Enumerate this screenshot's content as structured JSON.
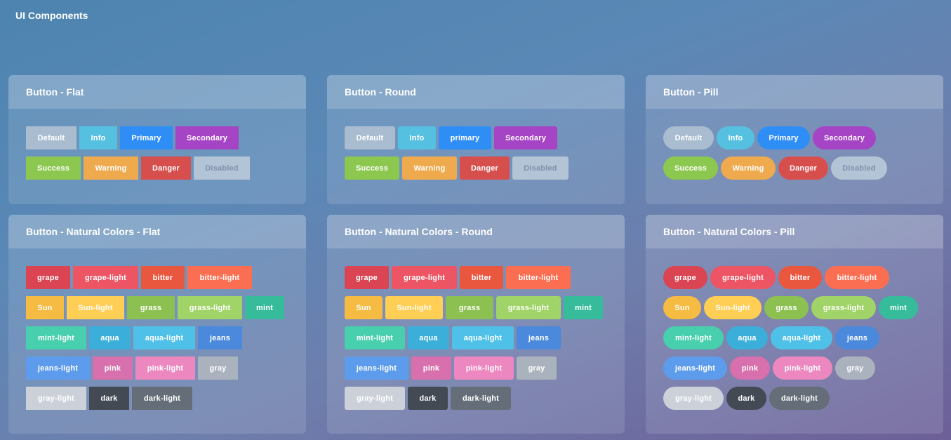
{
  "page": {
    "title": "UI Components"
  },
  "colors": {
    "default": "#aabdd0",
    "info": "#56c0e0",
    "primary": "#2f8ef5",
    "secondary": "#a544c4",
    "success": "#8cc74f",
    "warning": "#efaa4e",
    "danger": "#d74f4c",
    "disabled": "#b3c4d6",
    "grape": "#da4453",
    "grape-light": "#ed5565",
    "bitter": "#e9573f",
    "bitter-light": "#fc6e51",
    "sun": "#f6bb42",
    "sun-light": "#ffce54",
    "grass": "#8cc152",
    "grass-light": "#a0d468",
    "mint": "#37bc9b",
    "mint-light": "#48cfad",
    "aqua": "#3bafda",
    "aqua-light": "#4fc1e9",
    "jeans": "#4a89dc",
    "jeans-light": "#5d9cec",
    "pink": "#d770ad",
    "pink-light": "#ec87c0",
    "gray": "#aab2bd",
    "gray-light": "#ccd1d9",
    "dark": "#434a54",
    "dark-light": "#656d78"
  },
  "panels": [
    {
      "title": "Button - Flat",
      "style": "flat",
      "buttons": [
        {
          "label": "Default",
          "color": "default",
          "w": 72
        },
        {
          "label": "Info",
          "color": "info",
          "w": 54
        },
        {
          "label": "Primary",
          "color": "primary",
          "w": 75
        },
        {
          "label": "Secondary",
          "color": "secondary",
          "w": 90
        },
        {
          "label": "Success",
          "color": "success",
          "w": 78
        },
        {
          "label": "Warning",
          "color": "warning",
          "w": 78
        },
        {
          "label": "Danger",
          "color": "danger",
          "w": 71
        },
        {
          "label": "Disabled",
          "color": "disabled",
          "w": 80,
          "disabled": true
        }
      ]
    },
    {
      "title": "Button - Round",
      "style": "round",
      "buttons": [
        {
          "label": "Default",
          "color": "default",
          "w": 72
        },
        {
          "label": "Info",
          "color": "info",
          "w": 54
        },
        {
          "label": "primary",
          "color": "primary",
          "w": 75
        },
        {
          "label": "Secondary",
          "color": "secondary",
          "w": 90
        },
        {
          "label": "Success",
          "color": "success",
          "w": 78
        },
        {
          "label": "Warning",
          "color": "warning",
          "w": 78
        },
        {
          "label": "Danger",
          "color": "danger",
          "w": 71
        },
        {
          "label": "Disabled",
          "color": "disabled",
          "w": 80,
          "disabled": true
        }
      ]
    },
    {
      "title": "Button - Pill",
      "style": "pill",
      "buttons": [
        {
          "label": "Default",
          "color": "default",
          "w": 72
        },
        {
          "label": "Info",
          "color": "info",
          "w": 54
        },
        {
          "label": "Primary",
          "color": "primary",
          "w": 75
        },
        {
          "label": "Secondary",
          "color": "secondary",
          "w": 90
        },
        {
          "label": "Success",
          "color": "success",
          "w": 78
        },
        {
          "label": "Warning",
          "color": "warning",
          "w": 78
        },
        {
          "label": "Danger",
          "color": "danger",
          "w": 71
        },
        {
          "label": "Disabled",
          "color": "disabled",
          "w": 80,
          "disabled": true
        }
      ]
    },
    {
      "title": "Button - Natural Colors - Flat",
      "style": "flat",
      "buttons": [
        {
          "label": "grape",
          "color": "grape",
          "w": 63
        },
        {
          "label": "grape-light",
          "color": "grape-light",
          "w": 93
        },
        {
          "label": "bitter",
          "color": "bitter",
          "w": 62
        },
        {
          "label": "bitter-light",
          "color": "bitter-light",
          "w": 92
        },
        {
          "label": "Sun",
          "color": "sun",
          "w": 54
        },
        {
          "label": "Sun-light",
          "color": "sun-light",
          "w": 82
        },
        {
          "label": "grass",
          "color": "grass",
          "w": 68
        },
        {
          "label": "grass-light",
          "color": "grass-light",
          "w": 92
        },
        {
          "label": "mint",
          "color": "mint",
          "w": 56
        },
        {
          "label": "mint-light",
          "color": "mint-light",
          "w": 86
        },
        {
          "label": "aqua",
          "color": "aqua",
          "w": 59
        },
        {
          "label": "aqua-light",
          "color": "aqua-light",
          "w": 88
        },
        {
          "label": "jeans",
          "color": "jeans",
          "w": 63
        },
        {
          "label": "jeans-light",
          "color": "jeans-light",
          "w": 91
        },
        {
          "label": "pink",
          "color": "pink",
          "w": 57
        },
        {
          "label": "pink-light",
          "color": "pink-light",
          "w": 85
        },
        {
          "label": "gray",
          "color": "gray",
          "w": 57
        },
        {
          "label": "gray-light",
          "color": "gray-light",
          "w": 86
        },
        {
          "label": "dark",
          "color": "dark",
          "w": 57
        },
        {
          "label": "dark-light",
          "color": "dark-light",
          "w": 86
        }
      ]
    },
    {
      "title": "Button - Natural Colors - Round",
      "style": "round",
      "buttons": [
        {
          "label": "grape",
          "color": "grape",
          "w": 63
        },
        {
          "label": "grape-light",
          "color": "grape-light",
          "w": 93
        },
        {
          "label": "bitter",
          "color": "bitter",
          "w": 62
        },
        {
          "label": "bitter-light",
          "color": "bitter-light",
          "w": 92
        },
        {
          "label": "Sun",
          "color": "sun",
          "w": 54
        },
        {
          "label": "Sun-light",
          "color": "sun-light",
          "w": 82
        },
        {
          "label": "grass",
          "color": "grass",
          "w": 68
        },
        {
          "label": "grass-light",
          "color": "grass-light",
          "w": 92
        },
        {
          "label": "mint",
          "color": "mint",
          "w": 56
        },
        {
          "label": "mint-light",
          "color": "mint-light",
          "w": 86
        },
        {
          "label": "aqua",
          "color": "aqua",
          "w": 59
        },
        {
          "label": "aqua-light",
          "color": "aqua-light",
          "w": 88
        },
        {
          "label": "jeans",
          "color": "jeans",
          "w": 63
        },
        {
          "label": "jeans-light",
          "color": "jeans-light",
          "w": 91
        },
        {
          "label": "pink",
          "color": "pink",
          "w": 57
        },
        {
          "label": "pink-light",
          "color": "pink-light",
          "w": 85
        },
        {
          "label": "gray",
          "color": "gray",
          "w": 57
        },
        {
          "label": "gray-light",
          "color": "gray-light",
          "w": 86
        },
        {
          "label": "dark",
          "color": "dark",
          "w": 57
        },
        {
          "label": "dark-light",
          "color": "dark-light",
          "w": 86
        }
      ]
    },
    {
      "title": "Button - Natural Colors - Pill",
      "style": "pill",
      "buttons": [
        {
          "label": "grape",
          "color": "grape",
          "w": 63
        },
        {
          "label": "grape-light",
          "color": "grape-light",
          "w": 93
        },
        {
          "label": "bitter",
          "color": "bitter",
          "w": 62
        },
        {
          "label": "bitter-light",
          "color": "bitter-light",
          "w": 92
        },
        {
          "label": "Sun",
          "color": "sun",
          "w": 54
        },
        {
          "label": "Sun-light",
          "color": "sun-light",
          "w": 82
        },
        {
          "label": "grass",
          "color": "grass",
          "w": 63
        },
        {
          "label": "grass-light",
          "color": "grass-light",
          "w": 92
        },
        {
          "label": "mint",
          "color": "mint",
          "w": 56
        },
        {
          "label": "mint-light",
          "color": "mint-light",
          "w": 86
        },
        {
          "label": "aqua",
          "color": "aqua",
          "w": 59
        },
        {
          "label": "aqua-light",
          "color": "aqua-light",
          "w": 88
        },
        {
          "label": "jeans",
          "color": "jeans",
          "w": 63
        },
        {
          "label": "jeans-light",
          "color": "jeans-light",
          "w": 91
        },
        {
          "label": "pink",
          "color": "pink",
          "w": 57
        },
        {
          "label": "pink-light",
          "color": "pink-light",
          "w": 85
        },
        {
          "label": "gray",
          "color": "gray",
          "w": 57
        },
        {
          "label": "gray-light",
          "color": "gray-light",
          "w": 86
        },
        {
          "label": "dark",
          "color": "dark",
          "w": 57
        },
        {
          "label": "dark-light",
          "color": "dark-light",
          "w": 86
        }
      ]
    }
  ]
}
